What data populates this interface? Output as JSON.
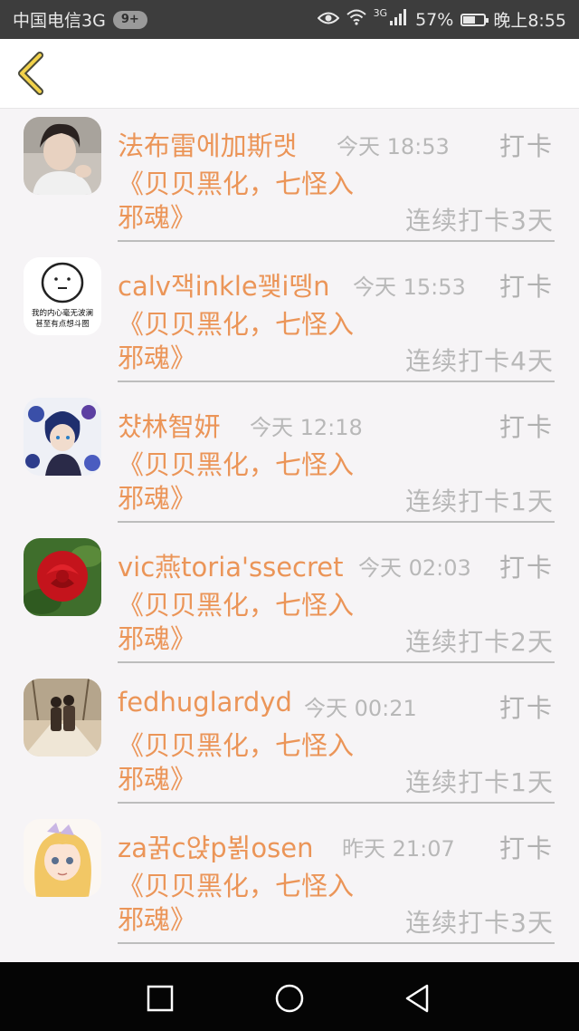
{
  "status_bar": {
    "carrier": "中国电信3G",
    "badge": "9+",
    "network_type": "3G",
    "battery": "57%",
    "battery_level": 0.57,
    "time": "晚上8:55"
  },
  "header": {
    "back_icon": "chevron-left-icon"
  },
  "entries": [
    {
      "name": "法布雷에加斯랫",
      "time": "今天 18:53",
      "action": "打卡",
      "task_line1": "《贝贝黑化，七怪入",
      "task_line2": "邪魂》",
      "streak": "连续打卡3天"
    },
    {
      "name": "calv잭inkle꽺i뗑n",
      "time": "今天 15:53",
      "action": "打卡",
      "task_line1": "《贝贝黑化，七怪入",
      "task_line2": "邪魂》",
      "streak": "连续打卡4天",
      "avatar_caption_1": "我的内心毫无波澜",
      "avatar_caption_2": "甚至有点想斗图"
    },
    {
      "name": "챴林智妍",
      "time": "今天 12:18",
      "action": "打卡",
      "task_line1": "《贝贝黑化，七怪入",
      "task_line2": "邪魂》",
      "streak": "连续打卡1天"
    },
    {
      "name": "vic燕toria'ssecret",
      "time": "今天 02:03",
      "action": "打卡",
      "task_line1": "《贝贝黑化，七怪入",
      "task_line2": "邪魂》",
      "streak": "连续打卡2天"
    },
    {
      "name": "fedhuglardyd",
      "time": "今天 00:21",
      "action": "打卡",
      "task_line1": "《贝贝黑化，七怪入",
      "task_line2": "邪魂》",
      "streak": "连续打卡1天"
    },
    {
      "name": "za꿁c얁p뵑osen",
      "time": "昨天 21:07",
      "action": "打卡",
      "task_line1": "《贝贝黑化，七怪入",
      "task_line2": "邪魂》",
      "streak": "连续打卡3天"
    }
  ],
  "nav_bar": {
    "recent_icon": "square-icon",
    "home_icon": "circle-icon",
    "back_icon": "triangle-back-icon"
  },
  "colors": {
    "accent": "#eb9558",
    "muted": "#b8b8b8",
    "status_bar": "#3d3d3d",
    "nav_bar": "#050505",
    "background": "#f6f4f6"
  }
}
